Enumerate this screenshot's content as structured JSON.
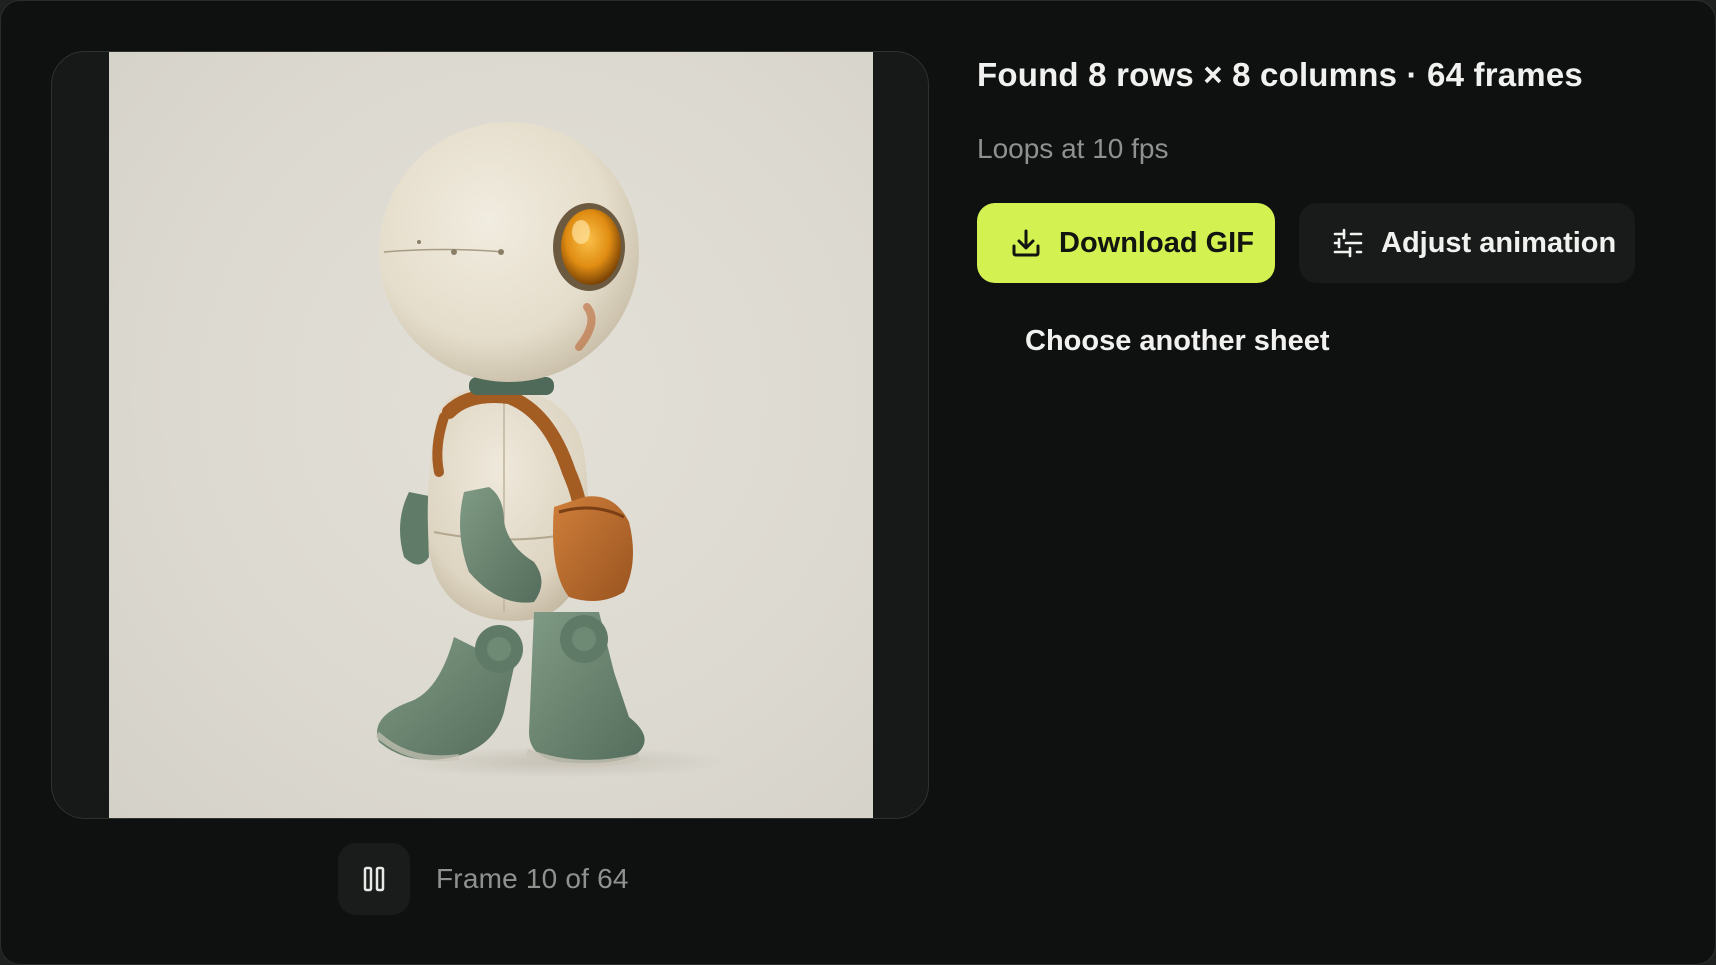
{
  "result": {
    "title": "Found 8 rows × 8 columns · 64 frames",
    "fps_text": "Loops at 10 fps"
  },
  "actions": {
    "download_label": "Download GIF",
    "download_icon": "download-icon",
    "adjust_label": "Adjust animation",
    "adjust_icon": "sliders-icon",
    "choose_label": "Choose another sheet"
  },
  "player": {
    "pause_icon": "pause-icon",
    "frame_text": "Frame 10 of 64",
    "current_frame": 10,
    "total_frames": 64
  },
  "preview": {
    "subject": "walking robot sprite frame"
  },
  "colors": {
    "accent": "#d3f151",
    "background": "#0f1110",
    "text_primary": "#f1f2f0",
    "text_secondary": "#8e928f"
  }
}
